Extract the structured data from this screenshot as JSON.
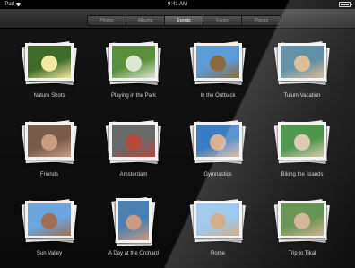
{
  "statusbar": {
    "device": "iPad",
    "time": "9:41 AM"
  },
  "tabs": [
    {
      "label": "Photos",
      "active": false
    },
    {
      "label": "Albums",
      "active": false
    },
    {
      "label": "Events",
      "active": true
    },
    {
      "label": "Faces",
      "active": false
    },
    {
      "label": "Places",
      "active": false
    }
  ],
  "events": [
    {
      "label": "Nature Shots",
      "colors": [
        "#3e6b2a",
        "#f3e7a1"
      ]
    },
    {
      "label": "Playing in the Park",
      "colors": [
        "#5a8f3c",
        "#dfe6d0"
      ]
    },
    {
      "label": "In the Outback",
      "colors": [
        "#5c9bd6",
        "#8c6a3e"
      ]
    },
    {
      "label": "Tulum Vacation",
      "colors": [
        "#4a7f9a",
        "#d9b48a"
      ]
    },
    {
      "label": "Friends",
      "colors": [
        "#7a5a48",
        "#c99c7f"
      ]
    },
    {
      "label": "Amsterdam",
      "colors": [
        "#6a6a6a",
        "#b34a3a"
      ]
    },
    {
      "label": "Gymnastics",
      "colors": [
        "#3b7cc4",
        "#d8b093"
      ]
    },
    {
      "label": "Biking the Islands",
      "colors": [
        "#3a8c3a",
        "#d9c6a6"
      ]
    },
    {
      "label": "Sun Valley",
      "colors": [
        "#6aa6e0",
        "#a07050"
      ]
    },
    {
      "label": "A Day at the Orchard",
      "colors": [
        "#4a7fb0",
        "#c99a80"
      ]
    },
    {
      "label": "Rome",
      "colors": [
        "#8fc0ea",
        "#c9a27a"
      ]
    },
    {
      "label": "Trip to Tikal",
      "colors": [
        "#5d8e48",
        "#d0b090"
      ]
    }
  ]
}
